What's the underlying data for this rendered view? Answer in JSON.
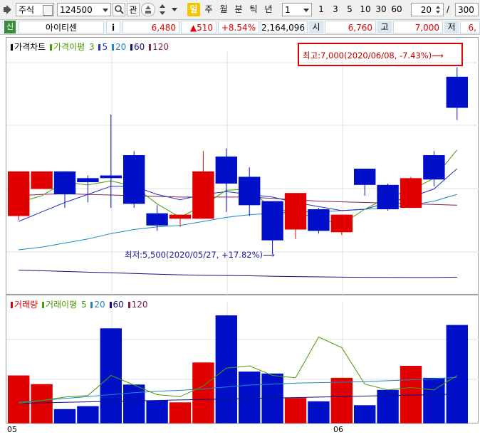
{
  "toolbar": {
    "market": "주식",
    "code": "124500",
    "search_icon": "magnifier-icon",
    "watch_label": "관",
    "periods": [
      "일",
      "주",
      "월",
      "분",
      "틱",
      "년"
    ],
    "active_period": "일",
    "interval_select": "1",
    "intervals": [
      "1",
      "3",
      "5",
      "10",
      "30",
      "60"
    ],
    "count": "20",
    "slash": "/",
    "total": "300"
  },
  "info": {
    "badge": "신",
    "name": "아이티센",
    "info_icon": "i",
    "price": "6,480",
    "change": "▲510",
    "rate": "+8.54%",
    "volume": "2,164,096",
    "open_label": "시",
    "open": "6,760",
    "high_label": "고",
    "high": "7,000",
    "low_label": "저",
    "low": "6,"
  },
  "price_panel": {
    "title": "가격차트",
    "ma_label": "가격이평",
    "ma": [
      "3",
      "5",
      "20",
      "60",
      "120"
    ],
    "max_annotation": "최고:7,000(2020/06/08, -7.43%)⟶",
    "min_annotation": "최저:5,500(2020/05/27, +17.82%)⟶"
  },
  "volume_panel": {
    "title": "거래량",
    "ma_label": "거래이평",
    "ma": [
      "5",
      "20",
      "60",
      "120"
    ]
  },
  "xaxis": {
    "labels": [
      "05",
      "06"
    ]
  },
  "colors": {
    "up": "#e00000",
    "down": "#0010c8",
    "ma3": "#4a9a00",
    "ma5": "#2030c8",
    "ma20": "#1e88c8",
    "ma60": "#101080",
    "ma120": "#802050"
  },
  "chart_data": {
    "type": "candlestick",
    "ylim": [
      5350,
      7050
    ],
    "candles": [
      {
        "open": 5900,
        "close": 6230,
        "high": 6230,
        "low": 5870,
        "up": true
      },
      {
        "open": 6230,
        "close": 6100,
        "high": 6230,
        "low": 6100,
        "up": true
      },
      {
        "open": 6230,
        "close": 6060,
        "high": 6230,
        "low": 5960,
        "up": false
      },
      {
        "open": 6180,
        "close": 6150,
        "high": 6200,
        "low": 6000,
        "up": false
      },
      {
        "open": 6200,
        "close": 6180,
        "high": 6650,
        "low": 5960,
        "up": false
      },
      {
        "open": 6350,
        "close": 5990,
        "high": 6380,
        "low": 5960,
        "up": false
      },
      {
        "open": 5920,
        "close": 5830,
        "high": 5980,
        "low": 5790,
        "up": false
      },
      {
        "open": 5910,
        "close": 5880,
        "high": 5910,
        "low": 5820,
        "up": true
      },
      {
        "open": 5880,
        "close": 6230,
        "high": 6380,
        "low": 5880,
        "up": true
      },
      {
        "open": 6340,
        "close": 6140,
        "high": 6400,
        "low": 5930,
        "up": false
      },
      {
        "open": 6190,
        "close": 5980,
        "high": 6260,
        "low": 5900,
        "up": false
      },
      {
        "open": 6010,
        "close": 5720,
        "high": 6010,
        "low": 5620,
        "up": false
      },
      {
        "open": 5800,
        "close": 6070,
        "high": 6070,
        "low": 5730,
        "up": true
      },
      {
        "open": 5950,
        "close": 5790,
        "high": 5960,
        "low": 5770,
        "up": false
      },
      {
        "open": 5780,
        "close": 5910,
        "high": 5910,
        "low": 5760,
        "up": true
      },
      {
        "open": 6250,
        "close": 6130,
        "high": 6250,
        "low": 6050,
        "up": false
      },
      {
        "open": 6130,
        "close": 5950,
        "high": 6140,
        "low": 5940,
        "up": false
      },
      {
        "open": 5960,
        "close": 6180,
        "high": 6190,
        "low": 5960,
        "up": true
      },
      {
        "open": 6350,
        "close": 6170,
        "high": 6380,
        "low": 6120,
        "up": false
      },
      {
        "open": 6930,
        "close": 6700,
        "high": 7000,
        "low": 6610,
        "up": false
      }
    ],
    "ma3": [
      6000,
      6050,
      6150,
      6130,
      6160,
      6120,
      5990,
      5890,
      5980,
      6090,
      6100,
      5950,
      5930,
      5880,
      5840,
      5950,
      6040,
      6090,
      6180,
      6390
    ],
    "ma5": [
      5860,
      5930,
      6000,
      6060,
      6120,
      6120,
      6060,
      6020,
      6060,
      6080,
      6060,
      6040,
      6000,
      5970,
      5940,
      5950,
      6000,
      6040,
      6100,
      6250
    ],
    "ma20": [
      5650,
      5670,
      5700,
      5730,
      5770,
      5800,
      5820,
      5830,
      5860,
      5890,
      5910,
      5920,
      5930,
      5930,
      5940,
      5950,
      5960,
      5980,
      6010,
      6060
    ],
    "ma60": [
      5500,
      5495,
      5490,
      5485,
      5480,
      5475,
      5470,
      5465,
      5462,
      5460,
      5458,
      5455,
      5452,
      5450,
      5448,
      5447,
      5446,
      5445,
      5445,
      5448
    ],
    "ma120": [
      6050,
      6060,
      6065,
      6060,
      6055,
      6050,
      6045,
      6040,
      6040,
      6040,
      6040,
      6030,
      6020,
      6010,
      6005,
      6000,
      5995,
      5990,
      5985,
      5980
    ],
    "volume": [
      100,
      82,
      30,
      36,
      198,
      81,
      48,
      44,
      127,
      225,
      108,
      104,
      53,
      46,
      95,
      38,
      70,
      120,
      95,
      205
    ],
    "vol_ma5": [
      42,
      48,
      55,
      58,
      100,
      80,
      60,
      56,
      78,
      115,
      120,
      100,
      95,
      180,
      158,
      82,
      70,
      75,
      70,
      100
    ],
    "vol_ma20": [
      44,
      48,
      52,
      56,
      60,
      64,
      67,
      69,
      72,
      76,
      80,
      82,
      84,
      85,
      86,
      87,
      89,
      91,
      93,
      96
    ],
    "vol_ma60": [
      42,
      43,
      44,
      45,
      46,
      47,
      48,
      49,
      50,
      51,
      52,
      53,
      54,
      55,
      56,
      57,
      58,
      59,
      60,
      61
    ],
    "vol_ylim": [
      0,
      240
    ]
  }
}
